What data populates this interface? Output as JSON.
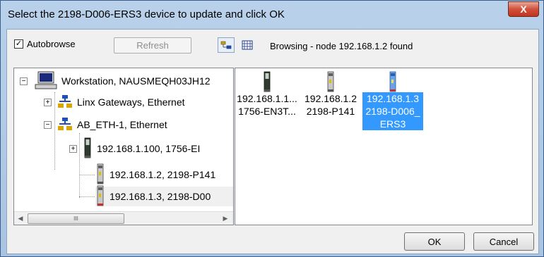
{
  "window": {
    "title": "Select the 2198-D006-ERS3 device to update and click OK",
    "close_glyph": "X"
  },
  "toolbar": {
    "autobrowse_label": "Autobrowse",
    "autobrowse_checked": true,
    "refresh_label": "Refresh",
    "status": "Browsing - node 192.168.1.2 found",
    "icons": [
      "browse-tree-icon",
      "list-view-icon"
    ]
  },
  "tree": {
    "nodes": [
      {
        "label": "Workstation, NAUSMEQH03JH12",
        "icon": "workstation-icon",
        "expander": "−"
      },
      {
        "label": "Linx Gateways, Ethernet",
        "icon": "network-icon",
        "expander": "+"
      },
      {
        "label": "AB_ETH-1, Ethernet",
        "icon": "network-icon",
        "expander": "−"
      },
      {
        "label": "192.168.1.100, 1756-EI",
        "icon": "module-icon",
        "expander": "+"
      },
      {
        "label": "192.168.1.2, 2198-P141",
        "icon": "drive-icon",
        "expander": ""
      },
      {
        "label": "192.168.1.3, 2198-D00",
        "icon": "drive-icon",
        "expander": "",
        "selected": true
      }
    ],
    "scroll_thumb_glyph": "III"
  },
  "devices": [
    {
      "line1": "192.168.1.1...",
      "line2": "1756-EN3T...",
      "line3": "",
      "icon": "module-icon",
      "selected": false
    },
    {
      "line1": "192.168.1.2",
      "line2": "2198-P141",
      "line3": "",
      "icon": "drive-icon",
      "selected": false
    },
    {
      "line1": "192.168.1.3",
      "line2": "2198-D006_",
      "line3": "ERS3",
      "icon": "drive-icon-blue",
      "selected": true
    }
  ],
  "buttons": {
    "ok_label": "OK",
    "cancel_label": "Cancel"
  },
  "colors": {
    "selection": "#3399ff",
    "title_bar": "#b9d1ea",
    "close_button": "#c0361f"
  }
}
